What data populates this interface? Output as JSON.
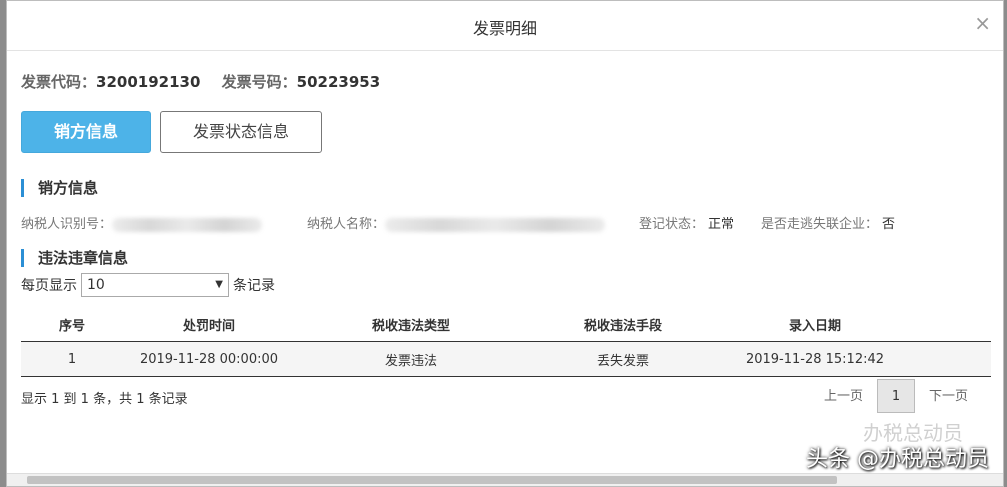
{
  "dialog": {
    "title": "发票明细",
    "close": "×"
  },
  "invoice": {
    "code_label": "发票代码：",
    "code_value": "3200192130",
    "number_label": "发票号码：",
    "number_value": "50223953"
  },
  "tabs": [
    {
      "label": "销方信息",
      "active": true
    },
    {
      "label": "发票状态信息",
      "active": false
    }
  ],
  "seller": {
    "section_title": "销方信息",
    "taxpayer_id_label": "纳税人识别号：",
    "taxpayer_name_label": "纳税人名称：",
    "reg_status_label": "登记状态：",
    "reg_status_value": "正常",
    "lost_label": "是否走逃失联企业：",
    "lost_value": "否"
  },
  "violations": {
    "section_title": "违法违章信息",
    "perpage_prefix": "每页显示",
    "perpage_value": "10",
    "perpage_suffix": "条记录",
    "columns": [
      "序号",
      "处罚时间",
      "税收违法类型",
      "税收违法手段",
      "录入日期"
    ],
    "rows": [
      [
        "1",
        "2019-11-28 00:00:00",
        "发票违法",
        "丢失发票",
        "2019-11-28 15:12:42"
      ]
    ],
    "summary": "显示 1 到 1 条，共 1 条记录",
    "pager": {
      "prev": "上一页",
      "current": "1",
      "next": "下一页"
    }
  },
  "watermark": {
    "text": "头条 @办税总动员",
    "ghost": "办税总动员"
  }
}
